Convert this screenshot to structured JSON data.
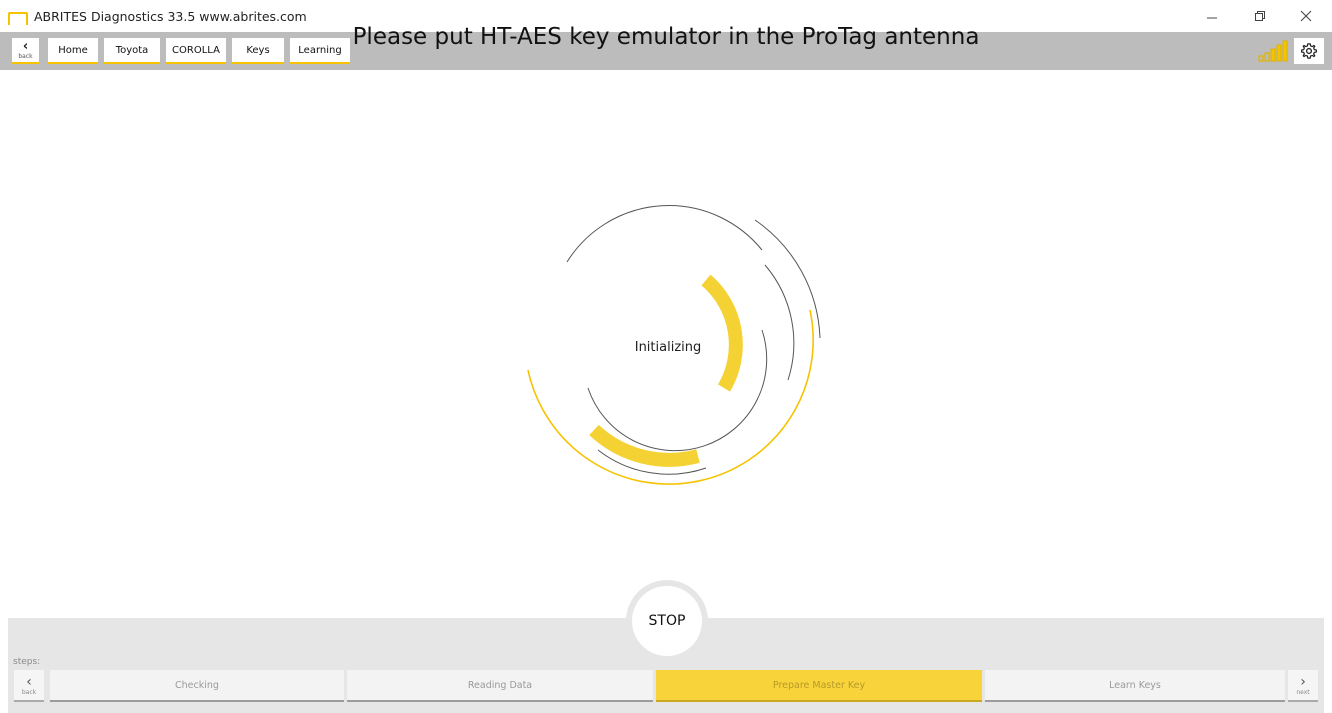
{
  "window": {
    "title": "ABRITES Diagnostics 33.5  www.abrites.com",
    "controls": [
      "minimize",
      "restore",
      "close"
    ]
  },
  "nav": {
    "back_label": "back",
    "breadcrumbs": [
      "Home",
      "Toyota",
      "COROLLA",
      "Keys",
      "Learning"
    ],
    "signal_icon": "signal-strength-icon",
    "settings_icon": "gear-icon"
  },
  "main": {
    "headline": "Please put HT-AES key emulator in the ProTag antenna",
    "status": "Initializing"
  },
  "controls": {
    "stop_label": "STOP"
  },
  "steps": {
    "label": "steps:",
    "back_label": "back",
    "next_label": "next",
    "items": [
      "Checking",
      "Reading Data",
      "Prepare Master Key",
      "Learn Keys"
    ],
    "active": "Prepare Master Key"
  },
  "colors": {
    "accent": "#f5c300",
    "active_step": "#f8d43a",
    "navbar": "#bcbcbc",
    "footer": "#e6e6e6"
  }
}
